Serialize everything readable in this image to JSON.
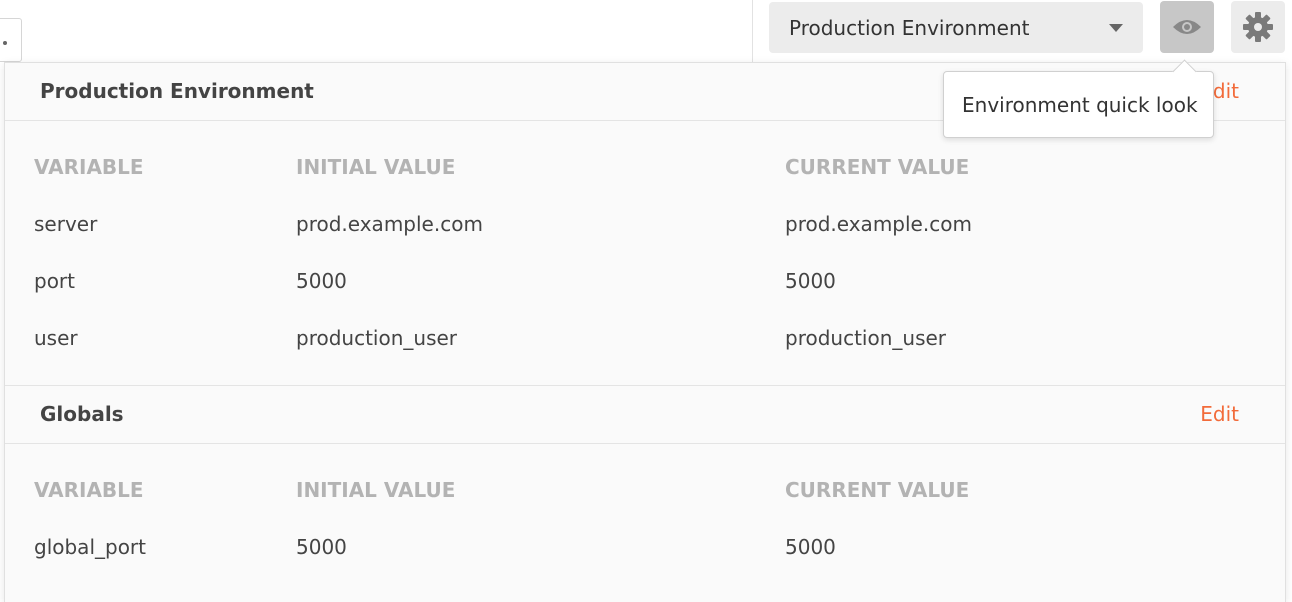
{
  "environment_selector": {
    "selected": "Production Environment"
  },
  "toolbar": {
    "quick_look_icon": "eye-icon",
    "settings_icon": "gear-icon"
  },
  "tooltip": {
    "text": "Environment quick look"
  },
  "quick_look": {
    "environment": {
      "title": "Production Environment",
      "edit_label": "Edit",
      "columns": [
        "VARIABLE",
        "INITIAL VALUE",
        "CURRENT VALUE"
      ],
      "rows": [
        [
          "server",
          "prod.example.com",
          "prod.example.com"
        ],
        [
          "port",
          "5000",
          "5000"
        ],
        [
          "user",
          "production_user",
          "production_user"
        ]
      ]
    },
    "globals": {
      "title": "Globals",
      "edit_label": "Edit",
      "columns": [
        "VARIABLE",
        "INITIAL VALUE",
        "CURRENT VALUE"
      ],
      "rows": [
        [
          "global_port",
          "5000",
          "5000"
        ]
      ]
    }
  },
  "colors": {
    "accent": "#f26b3a",
    "column_header": "#b3b3b3"
  }
}
